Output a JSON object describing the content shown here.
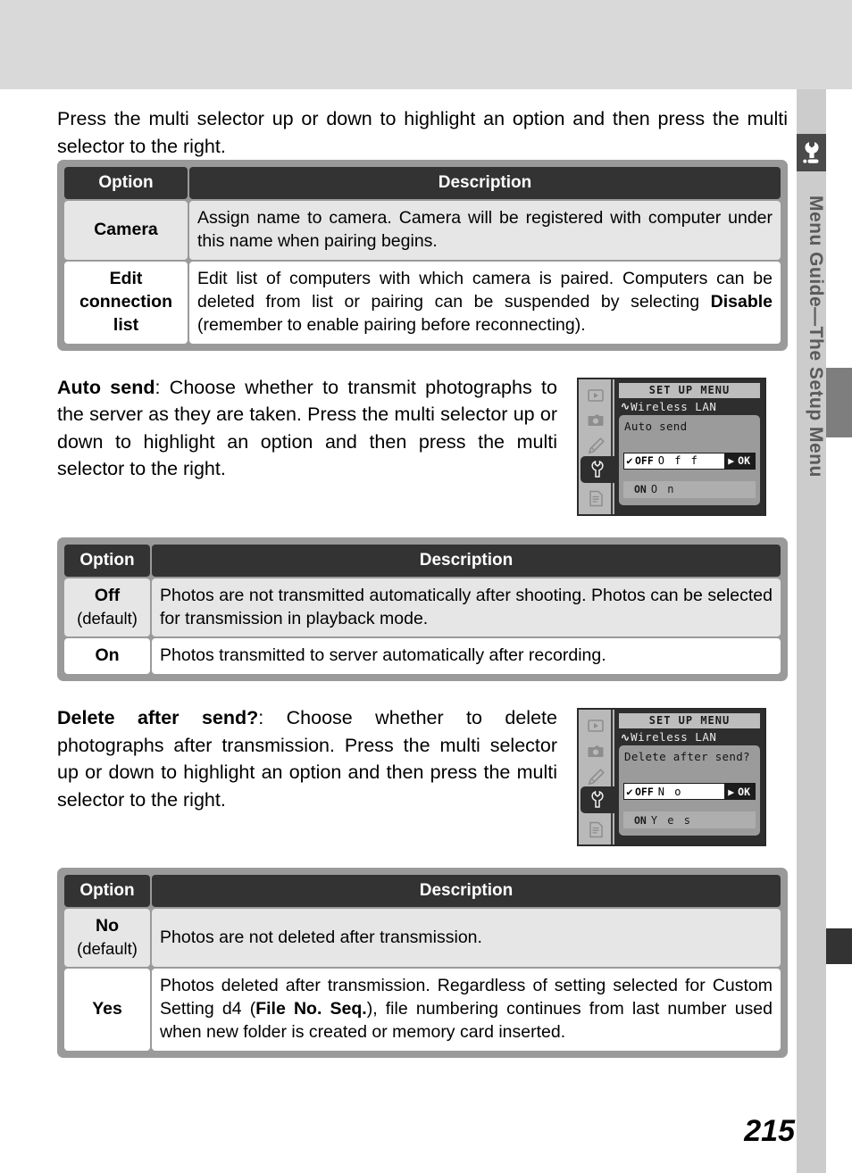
{
  "page": {
    "number": "215",
    "sidebar_title": "Menu Guide—The Setup Menu",
    "sidebar_icon": "wrench-icon"
  },
  "intro": {
    "text": "Press the multi selector up or down to highlight an option and then press the multi selector to the right."
  },
  "table_connection": {
    "headers": {
      "option": "Option",
      "description": "Description"
    },
    "rows": [
      {
        "option": "Camera",
        "default_note": "",
        "description": "Assign name to camera.  Camera will be registered with computer under this name when pairing begins."
      },
      {
        "option": "Edit connection list",
        "default_note": "",
        "description_pre": "Edit list of computers with which camera is paired.  Computers can be deleted from list or pairing can be suspended by selecting ",
        "description_bold": "Disable",
        "description_post": " (remember to enable pairing before reconnecting)."
      }
    ]
  },
  "auto_send": {
    "term": "Auto send",
    "body": ": Choose whether to transmit photographs to the server as they are taken.  Press the multi selector up or down to highlight an option and then press the multi selector to the right.",
    "lcd": {
      "menu_title": "SET UP MENU",
      "breadcrumb": "Wireless LAN",
      "heading": "Auto send",
      "selected_row": {
        "check": "✔",
        "flag": "OFF",
        "label": "O f f"
      },
      "other_row": {
        "check": "",
        "flag": "ON",
        "label": "O n"
      },
      "ok_label": "OK",
      "side_icons": [
        "playback-icon",
        "camera-icon",
        "pencil-icon",
        "wrench-icon",
        "recent-settings-icon"
      ],
      "selected_side_icon": "wrench-icon"
    }
  },
  "table_auto_send": {
    "headers": {
      "option": "Option",
      "description": "Description"
    },
    "rows": [
      {
        "option": "Off",
        "default_note": "(default)",
        "description": "Photos are not transmitted automatically after shooting.  Photos can be selected for transmission in playback mode."
      },
      {
        "option": "On",
        "default_note": "",
        "description": "Photos transmitted to server automatically after recording."
      }
    ]
  },
  "delete_after_send": {
    "term": "Delete after send?",
    "body": ": Choose whether to delete photographs after transmission.  Press the multi selector up or down to highlight an option and then press the multi selector to the right.",
    "lcd": {
      "menu_title": "SET UP MENU",
      "breadcrumb": "Wireless LAN",
      "heading": "Delete after send?",
      "selected_row": {
        "check": "✔",
        "flag": "OFF",
        "label": "N o"
      },
      "other_row": {
        "check": "",
        "flag": "ON",
        "label": "Y e s"
      },
      "ok_label": "OK",
      "side_icons": [
        "playback-icon",
        "camera-icon",
        "pencil-icon",
        "wrench-icon",
        "recent-settings-icon"
      ],
      "selected_side_icon": "wrench-icon"
    }
  },
  "table_delete": {
    "headers": {
      "option": "Option",
      "description": "Description"
    },
    "rows": [
      {
        "option": "No",
        "default_note": "(default)",
        "description": "Photos are not deleted after transmission."
      },
      {
        "option": "Yes",
        "default_note": "",
        "description_pre": "Photos deleted after transmission.  Regardless of setting selected for Custom Setting d4 (",
        "description_bold": "File No. Seq.",
        "description_post": "), file numbering continues from last number used when new folder is created or memory card inserted."
      }
    ]
  },
  "colors": {
    "header_bg": "#333333",
    "table_border": "#9a9a9a",
    "shaded_row": "#e6e6e6",
    "top_band": "#d9d9d9",
    "rail": "#cccccc",
    "tab_gray": "#7e7e7e",
    "tab_dark": "#333333"
  }
}
